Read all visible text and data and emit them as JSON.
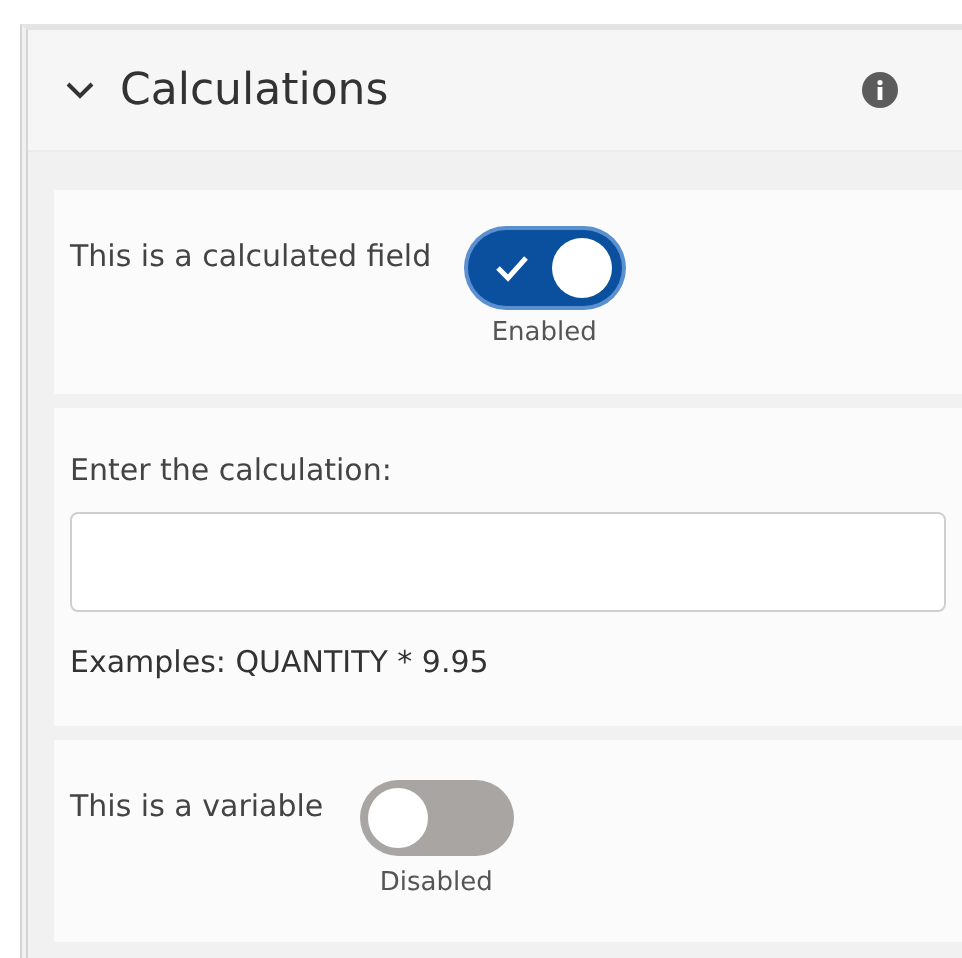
{
  "panel": {
    "title": "Calculations",
    "expanded": true
  },
  "sections": [
    {
      "kind": "toggle",
      "label": "This is a calculated field",
      "on": true,
      "state_text": "Enabled"
    },
    {
      "kind": "input",
      "label": "Enter the calculation:",
      "hint": "Examples: QUANTITY * 9.95"
    },
    {
      "kind": "toggle",
      "label": "This is a variable",
      "on": false,
      "state_text": "Disabled"
    }
  ]
}
